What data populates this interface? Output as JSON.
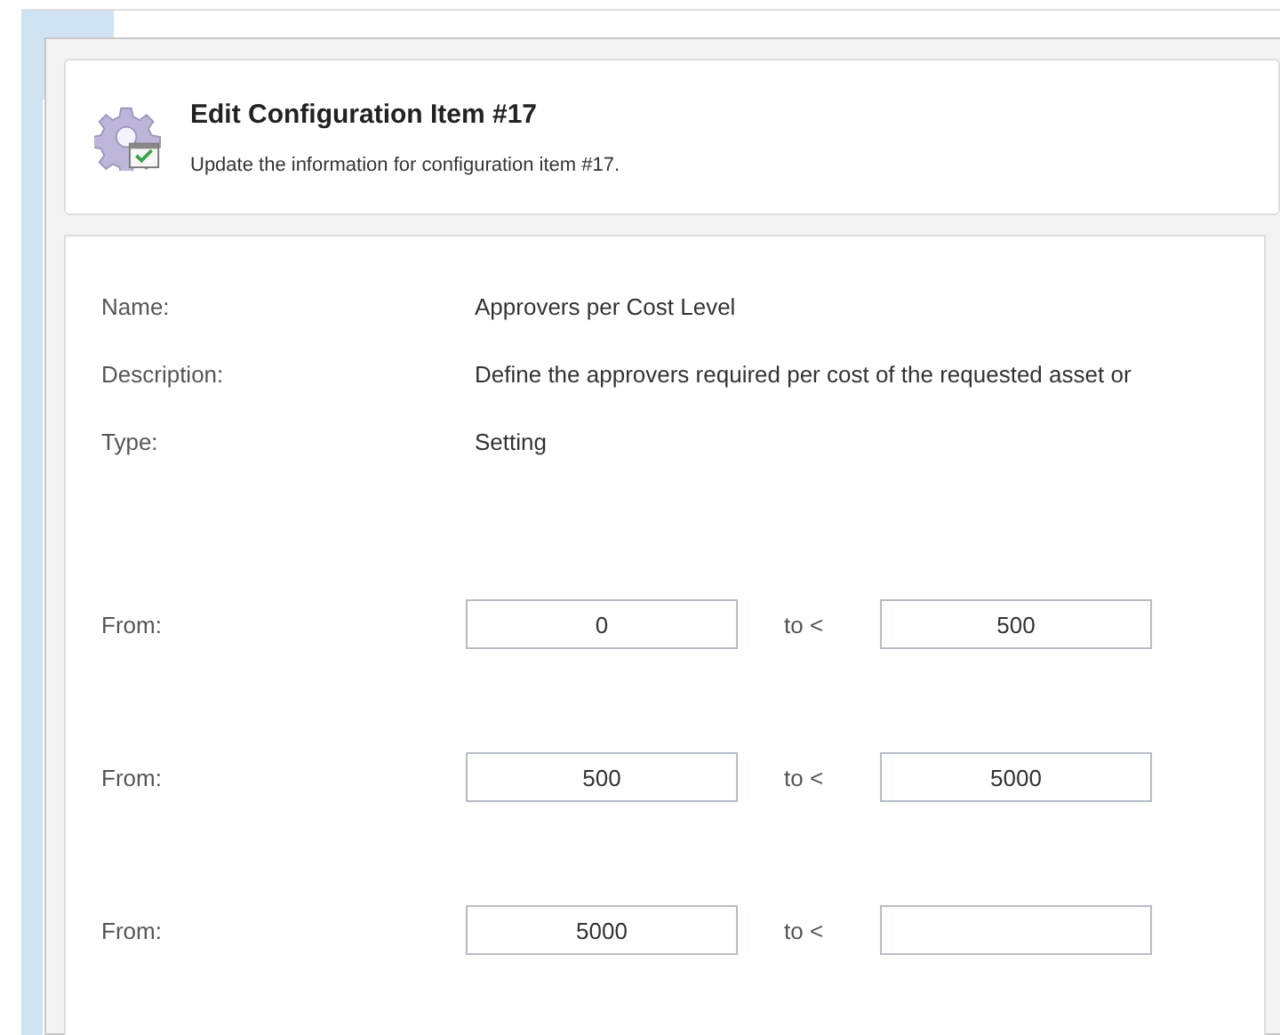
{
  "header": {
    "title": "Edit Configuration Item #17",
    "subtitle": "Update the information for configuration item #17."
  },
  "fields": [
    {
      "label": "Name:",
      "value": "Approvers per Cost Level"
    },
    {
      "label": "Description:",
      "value": "Define the approvers required per cost of the requested asset or"
    },
    {
      "label": "Type:",
      "value": "Setting"
    }
  ],
  "ranges": [
    {
      "label": "From:",
      "from": "0",
      "separator": "to <",
      "to": "500"
    },
    {
      "label": "From:",
      "from": "500",
      "separator": "to <",
      "to": "5000"
    },
    {
      "label": "From:",
      "from": "5000",
      "separator": "to <"
    }
  ]
}
